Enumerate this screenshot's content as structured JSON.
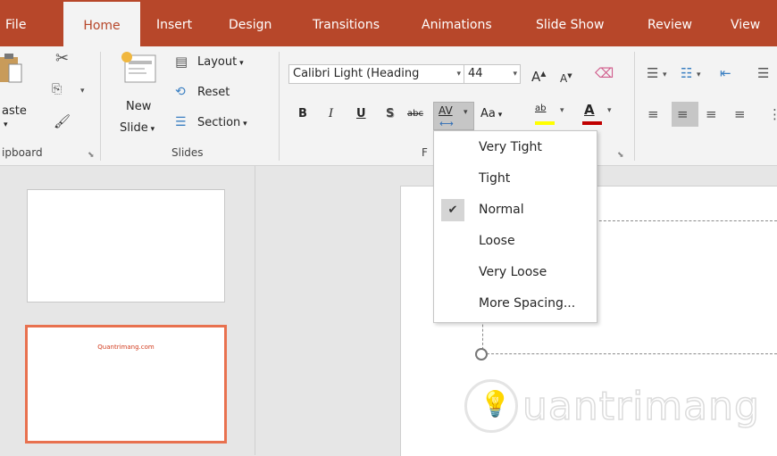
{
  "tabs": [
    {
      "label": "File",
      "active": false
    },
    {
      "label": "Home",
      "active": true
    },
    {
      "label": "Insert",
      "active": false
    },
    {
      "label": "Design",
      "active": false
    },
    {
      "label": "Transitions",
      "active": false
    },
    {
      "label": "Animations",
      "active": false
    },
    {
      "label": "Slide Show",
      "active": false
    },
    {
      "label": "Review",
      "active": false
    },
    {
      "label": "View",
      "active": false
    }
  ],
  "clipboard": {
    "paste_label": "aste",
    "group_label": "ipboard"
  },
  "slides_group": {
    "new_slide_line1": "New",
    "new_slide_line2": "Slide",
    "layout_label": "Layout",
    "reset_label": "Reset",
    "section_label": "Section",
    "group_label": "Slides"
  },
  "font_group": {
    "font_name": "Calibri Light (Heading",
    "font_size": "44",
    "group_label_partial": "F",
    "bold": "B",
    "italic": "I",
    "underline": "U",
    "shadow": "S",
    "strikethrough": "abc",
    "spacing": "AV",
    "change_case": "Aa",
    "highlight": "ab",
    "font_color": "A"
  },
  "spacing_menu": {
    "items": [
      {
        "label": "Very Tight",
        "checked": false
      },
      {
        "label": "Tight",
        "checked": false
      },
      {
        "label": "Normal",
        "checked": true
      },
      {
        "label": "Loose",
        "checked": false
      },
      {
        "label": "Very Loose",
        "checked": false
      },
      {
        "label": "More Spacing...",
        "checked": false
      }
    ]
  },
  "thumbnails": [
    {
      "text": ""
    },
    {
      "text": "Quantrimang.com"
    }
  ],
  "watermark": "uantrimang",
  "colors": {
    "accent": "#b7472a",
    "selected_slide_border": "#e8714f",
    "font_color_bar": "#c00000",
    "highlight_bar": "#ffff00",
    "spacing_underline": "#2f6db5"
  },
  "icons": [
    "cut-icon",
    "copy-icon",
    "format-painter-icon",
    "paste-icon",
    "new-slide-icon",
    "layout-icon",
    "reset-icon",
    "section-icon",
    "grow-font-icon",
    "shrink-font-icon",
    "clear-format-icon",
    "bullets-icon",
    "numbering-icon",
    "decrease-indent-icon",
    "align-left-icon",
    "align-center-icon",
    "align-right-icon",
    "justify-icon",
    "dialog-launcher-icon",
    "check-icon",
    "rotate-handle-icon"
  ]
}
